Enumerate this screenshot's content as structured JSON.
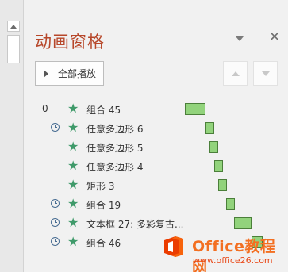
{
  "panel": {
    "title": "动画窗格",
    "play_all_label": "全部播放"
  },
  "animations": [
    {
      "index": "0",
      "has_timing_icon": false,
      "name": "组合 45"
    },
    {
      "index": "",
      "has_timing_icon": true,
      "name": "任意多边形 6"
    },
    {
      "index": "",
      "has_timing_icon": false,
      "name": "任意多边形 5"
    },
    {
      "index": "",
      "has_timing_icon": false,
      "name": "任意多边形 4"
    },
    {
      "index": "",
      "has_timing_icon": false,
      "name": "矩形 3"
    },
    {
      "index": "",
      "has_timing_icon": true,
      "name": "组合 19"
    },
    {
      "index": "",
      "has_timing_icon": true,
      "name": "文本框 27: 多彩复古..."
    },
    {
      "index": "",
      "has_timing_icon": true,
      "name": "组合 46"
    }
  ],
  "watermark": {
    "brand": "Office教程网",
    "url": "www.office26.com"
  },
  "colors": {
    "title": "#b7472a",
    "effect_icon": "#3f9a6a",
    "bar_fill": "#92d37c",
    "bar_border": "#4b7f3a",
    "watermark": "#f36f21"
  }
}
